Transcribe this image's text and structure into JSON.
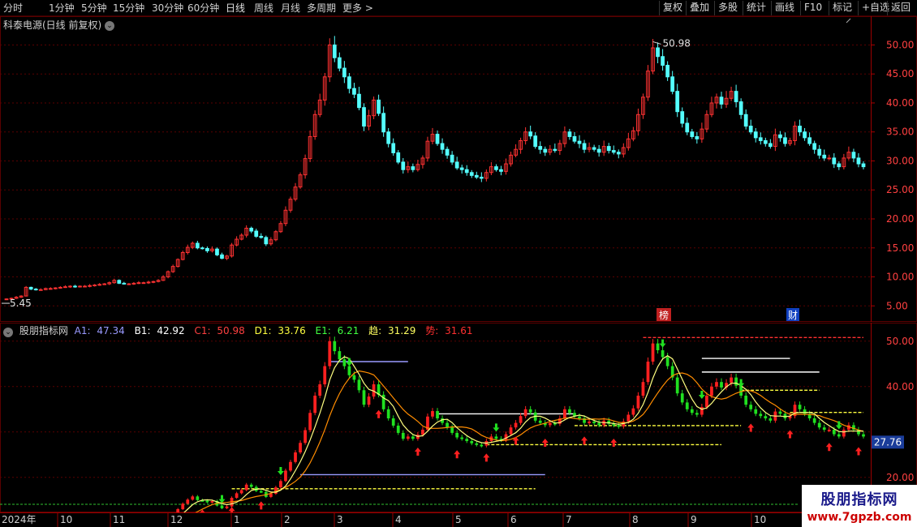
{
  "toolbar": {
    "periods": [
      "分时",
      "1分钟",
      "5分钟",
      "15分钟",
      "30分钟",
      "60分钟",
      "日线",
      "周线",
      "月线",
      "多周期",
      "更多 >"
    ],
    "active_period": "日线",
    "actions": [
      "复权",
      "叠加",
      "多股",
      "统计",
      "画线",
      "F10",
      "+自选",
      "返回"
    ],
    "mark_label": "标记"
  },
  "main": {
    "title": "科泰电源(日线 前复权)",
    "high_label": "50.98",
    "low_label": "5.45",
    "marker_top": "榜",
    "marker_fin": "财",
    "y_ticks": [
      "50.00",
      "45.00",
      "40.00",
      "35.00",
      "30.00",
      "25.00",
      "20.00",
      "15.00",
      "10.00",
      "5.00"
    ]
  },
  "sub": {
    "name": "股朋指标网",
    "A1_label": "A1:",
    "A1_value": "47.34",
    "B1_label": "B1:",
    "B1_value": "42.92",
    "C1_label": "C1:",
    "C1_value": "50.98",
    "D1_label": "D1:",
    "D1_value": "33.76",
    "E1_label": "E1:",
    "E1_value": "6.21",
    "trend_label": "趋:",
    "trend_value": "31.29",
    "power_label": "势:",
    "power_value": "31.61",
    "y_ticks": [
      "50.00",
      "40.00",
      "20.00"
    ],
    "current_price": "27.76"
  },
  "x_axis": {
    "year_label": "2024年",
    "months": [
      "10",
      "11",
      "12",
      "1",
      "2",
      "3",
      "4",
      "5",
      "6",
      "7",
      "8",
      "9",
      "10"
    ]
  },
  "brand": {
    "name": "股朋指标网",
    "url": "www.7gpzb.com"
  },
  "colors": {
    "up": "#ff3232",
    "down": "#54ffff",
    "sub_up": "#ff2020",
    "sub_down": "#20e020",
    "grid": "#5a0000",
    "axis_text": "#ff4040"
  },
  "chart_data": {
    "type": "candlestick",
    "y_range_main": [
      3.5,
      53
    ],
    "y_range_sub": [
      13,
      53
    ],
    "close_series": [
      6.2,
      6.3,
      6.5,
      6.7,
      8.2,
      7.9,
      7.8,
      7.8,
      8.0,
      8.0,
      8.1,
      8.2,
      8.3,
      8.4,
      8.3,
      8.4,
      8.4,
      8.5,
      8.6,
      8.7,
      8.8,
      9.0,
      9.4,
      8.9,
      8.8,
      8.8,
      8.9,
      9.0,
      9.0,
      9.1,
      9.2,
      9.4,
      10.0,
      10.9,
      11.8,
      13.0,
      14.2,
      15.1,
      15.8,
      15.0,
      14.9,
      14.5,
      14.8,
      13.8,
      13.2,
      13.6,
      15.5,
      16.5,
      17.2,
      18.4,
      17.9,
      17.0,
      16.8,
      15.7,
      16.4,
      17.8,
      19.2,
      21.5,
      23.4,
      25.5,
      27.6,
      30.4,
      34.2,
      38.0,
      40.5,
      44.5,
      50.0,
      47.8,
      46.0,
      44.5,
      42.5,
      41.5,
      39.2,
      36.0,
      37.8,
      40.5,
      38.2,
      35.0,
      33.0,
      31.4,
      29.8,
      28.5,
      29.0,
      28.5,
      29.4,
      30.5,
      33.4,
      34.6,
      33.0,
      32.0,
      31.0,
      29.8,
      28.8,
      28.5,
      28.0,
      27.5,
      27.2,
      27.0,
      28.0,
      29.0,
      28.5,
      28.2,
      29.5,
      31.0,
      32.0,
      33.5,
      35.0,
      34.3,
      32.5,
      32.0,
      31.5,
      32.0,
      31.8,
      33.0,
      35.0,
      34.2,
      33.4,
      33.0,
      32.0,
      32.3,
      32.0,
      31.5,
      32.5,
      31.8,
      31.5,
      31.2,
      32.3,
      33.8,
      35.2,
      38.0,
      41.0,
      45.5,
      49.5,
      48.0,
      46.5,
      44.5,
      42.0,
      38.5,
      36.5,
      35.0,
      34.2,
      33.8,
      35.5,
      38.0,
      40.0,
      41.0,
      39.8,
      40.8,
      42.0,
      40.2,
      38.0,
      36.0,
      35.0,
      34.0,
      33.5,
      33.0,
      32.5,
      34.5,
      34.0,
      33.0,
      33.5,
      36.0,
      35.0,
      34.0,
      33.0,
      32.0,
      31.0,
      30.5,
      30.5,
      29.5,
      29.0,
      30.5,
      31.5,
      30.5,
      29.5,
      29.0
    ]
  }
}
